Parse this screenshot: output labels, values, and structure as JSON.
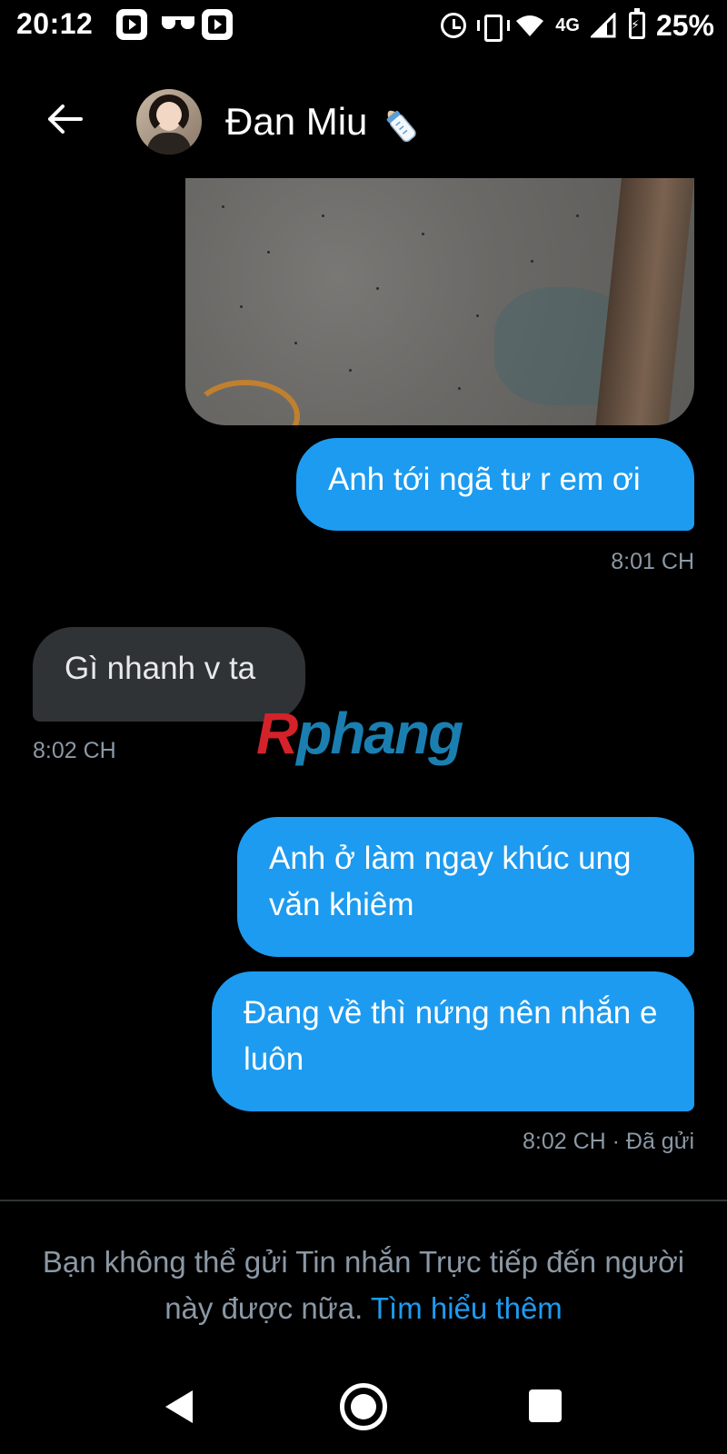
{
  "status_bar": {
    "time": "20:12",
    "network": "4G",
    "battery": "25%",
    "icons": [
      "play-app-icon",
      "glasses-icon",
      "play-app-icon",
      "alarm-icon",
      "vibrate-icon",
      "wifi-icon",
      "signal-icon",
      "battery-icon"
    ]
  },
  "header": {
    "contact_name": "Đan Miu",
    "emoji_icon": "baby-bottle-icon"
  },
  "messages": [
    {
      "direction": "out",
      "type": "image",
      "text": ""
    },
    {
      "direction": "out",
      "text": "Anh tới ngã tư r em ơi"
    },
    {
      "direction": "in",
      "text": "Gì nhanh v ta"
    },
    {
      "direction": "out",
      "text": "Anh ở làm ngay khúc ung văn khiêm"
    },
    {
      "direction": "out",
      "text": "Đang về thì nứng nên nhắn e luôn"
    }
  ],
  "timestamps": {
    "t1": "8:01 CH",
    "t2": "8:02 CH",
    "t3": "8:02 CH · Đã gửi"
  },
  "watermark": {
    "first": "R",
    "rest": "phang"
  },
  "notice": {
    "text": "Bạn không thể gửi Tin nhắn Trực tiếp đến người này được nữa.",
    "link": "Tìm hiểu thêm"
  },
  "colors": {
    "background": "#000000",
    "outgoing_bubble": "#1d9bf0",
    "incoming_bubble": "#2f3336",
    "link": "#1d9bf0",
    "muted_text": "#8b98a5"
  }
}
